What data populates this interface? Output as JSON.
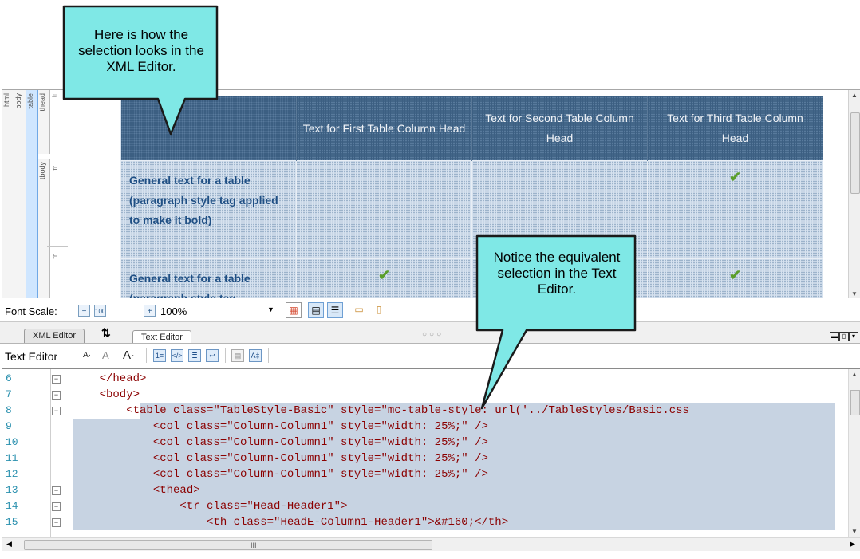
{
  "xml_editor": {
    "structure_bars": [
      "html",
      "body",
      "table",
      "thead",
      "tr"
    ],
    "tbody_label": "tbody",
    "tr_label": "tr",
    "table": {
      "headers": [
        "",
        "Text for First Table Column Head",
        "Text for Second Table Column Head",
        "Text for Third Table Column Head"
      ],
      "rows": [
        {
          "label": "General text for a table (paragraph style tag applied to make it bold)",
          "checks": [
            false,
            false,
            true
          ]
        },
        {
          "label": "General text for a table (paragraph style tag",
          "checks": [
            true,
            false,
            true
          ]
        }
      ]
    }
  },
  "font_scale": {
    "label": "Font Scale:",
    "minus": "−",
    "plus": "+",
    "value": "100%"
  },
  "tabs": [
    {
      "label": "XML Editor",
      "active": false
    },
    {
      "label": "Text Editor",
      "active": true
    }
  ],
  "text_editor_toolbar": {
    "label": "Text Editor"
  },
  "code": {
    "lines": [
      {
        "num": "6",
        "text": "    </head>",
        "highlight": false,
        "fold": true
      },
      {
        "num": "7",
        "text": "    <body>",
        "highlight": false,
        "fold": true
      },
      {
        "num": "8",
        "text": "        <table class=\"TableStyle-Basic\" style=\"mc-table-style: url('../TableStyles/Basic.css",
        "highlight": true,
        "fold": true,
        "partial": true
      },
      {
        "num": "9",
        "text": "            <col class=\"Column-Column1\" style=\"width: 25%;\" />",
        "highlight": true,
        "fold": false
      },
      {
        "num": "10",
        "text": "            <col class=\"Column-Column1\" style=\"width: 25%;\" />",
        "highlight": true,
        "fold": false
      },
      {
        "num": "11",
        "text": "            <col class=\"Column-Column1\" style=\"width: 25%;\" />",
        "highlight": true,
        "fold": false
      },
      {
        "num": "12",
        "text": "            <col class=\"Column-Column1\" style=\"width: 25%;\" />",
        "highlight": true,
        "fold": false
      },
      {
        "num": "13",
        "text": "            <thead>",
        "highlight": true,
        "fold": true
      },
      {
        "num": "14",
        "text": "                <tr class=\"Head-Header1\">",
        "highlight": true,
        "fold": true
      },
      {
        "num": "15",
        "text": "                    <th class=\"HeadE-Column1-Header1\">&#160;</th>",
        "highlight": true,
        "fold": true
      }
    ]
  },
  "callouts": {
    "top": "Here is how the selection looks in the XML Editor.",
    "bottom": "Notice the equivalent selection in the Text Editor."
  },
  "colors": {
    "callout_fill": "#7fe8e6",
    "header_bg": "#3c5f82",
    "cell_text": "#1f4f84",
    "selection": "#c7d3e2"
  }
}
